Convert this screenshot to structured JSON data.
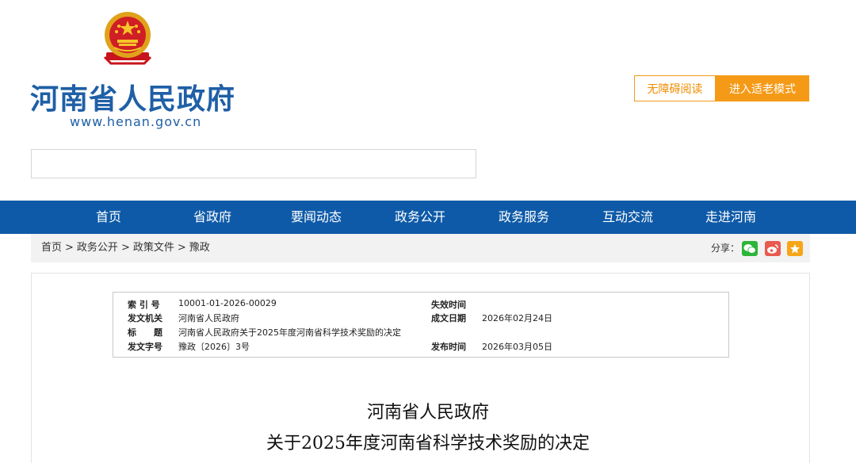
{
  "header": {
    "site_name": "河南省人民政府",
    "site_url": "www.henan.gov.cn",
    "accessibility_label": "无障碍阅读",
    "elder_mode_label": "进入适老模式"
  },
  "search": {
    "value": "",
    "placeholder": ""
  },
  "nav": {
    "items": [
      "首页",
      "省政府",
      "要闻动态",
      "政务公开",
      "政务服务",
      "互动交流",
      "走进河南"
    ]
  },
  "breadcrumb": {
    "items": [
      "首页",
      "政务公开",
      "政策文件",
      "豫政"
    ],
    "separator": ">"
  },
  "share": {
    "label": "分享："
  },
  "meta": {
    "index_no_label": "索 引 号",
    "index_no": "10001-01-2026-00029",
    "issuer_label": "发文机关",
    "issuer": "河南省人民政府",
    "title_label": "标　　题",
    "title": "河南省人民政府关于2025年度河南省科学技术奖励的决定",
    "doc_no_label": "发文字号",
    "doc_no": "豫政〔2026〕3号",
    "expiry_label": "失效时间",
    "expiry": "",
    "created_label": "成文日期",
    "created": "2026年02月24日",
    "published_label": "发布时间",
    "published": "2026年03月05日"
  },
  "document": {
    "title_line1": "河南省人民政府",
    "title_line2": "关于2025年度河南省科学技术奖励的决定"
  },
  "colors": {
    "brand_blue": "#1f5fa6",
    "nav_blue": "#0e5aa8",
    "accent_orange": "#f59a16"
  }
}
